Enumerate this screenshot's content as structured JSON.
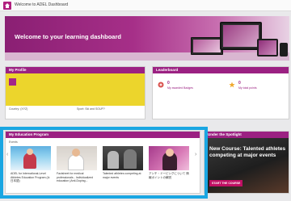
{
  "header": {
    "title": "Welcome to ADEL Dashboard"
  },
  "hero": {
    "title": "Welcome to your learning dashboard"
  },
  "profile": {
    "title": "My Profile",
    "country": "Country: (XYZ)",
    "sport": "Sport: Ski and SOUP?"
  },
  "leaderboard": {
    "title": "Leaderboard",
    "badges": {
      "count": "0",
      "label": "My awarded Badges"
    },
    "points": {
      "count": "0",
      "label": "My total points"
    }
  },
  "education": {
    "title": "My Education Program",
    "filter_label": "Events",
    "courses": [
      {
        "title": "ADEL for International-Level Athletes Education Program (A: 日本語)"
      },
      {
        "title": "Factsheet for medical professionals - Individualized education (Anti-Doping..."
      },
      {
        "title": "Talented athletes competing at major events"
      },
      {
        "title": "アンチ・ドーピングについて 情報ポイントの解説"
      }
    ]
  },
  "spotlight": {
    "title": "Under the Spotlight",
    "headline": "New Course: Talented athletes competing at major events",
    "cta": "START THE COURSE"
  },
  "colors": {
    "brand": "#9b2182",
    "highlight": "#1aa6e2",
    "accent_yellow": "#ecd52c"
  }
}
